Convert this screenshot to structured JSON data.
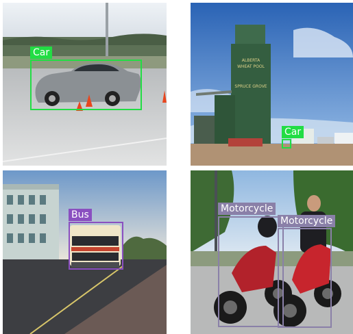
{
  "colors": {
    "car_box": "#22dd44",
    "bus_box": "#8a4fc0",
    "motorcycle_box": "#8a80a8",
    "label_text": "#ffffff"
  },
  "panels": [
    {
      "scene": "car-track",
      "detections": [
        {
          "label": "Car",
          "class": "car"
        }
      ]
    },
    {
      "scene": "grain-elevator",
      "signage": [
        "ALBERTA",
        "WHEAT POOL",
        "SPRUCE GROVE"
      ],
      "detections": [
        {
          "label": "Car",
          "class": "car"
        }
      ]
    },
    {
      "scene": "city-street",
      "detections": [
        {
          "label": "Bus",
          "class": "bus"
        }
      ]
    },
    {
      "scene": "motorcycles",
      "detections": [
        {
          "label": "Motorcycle",
          "class": "motorcycle"
        },
        {
          "label": "Motorcycle",
          "class": "motorcycle"
        }
      ]
    }
  ]
}
